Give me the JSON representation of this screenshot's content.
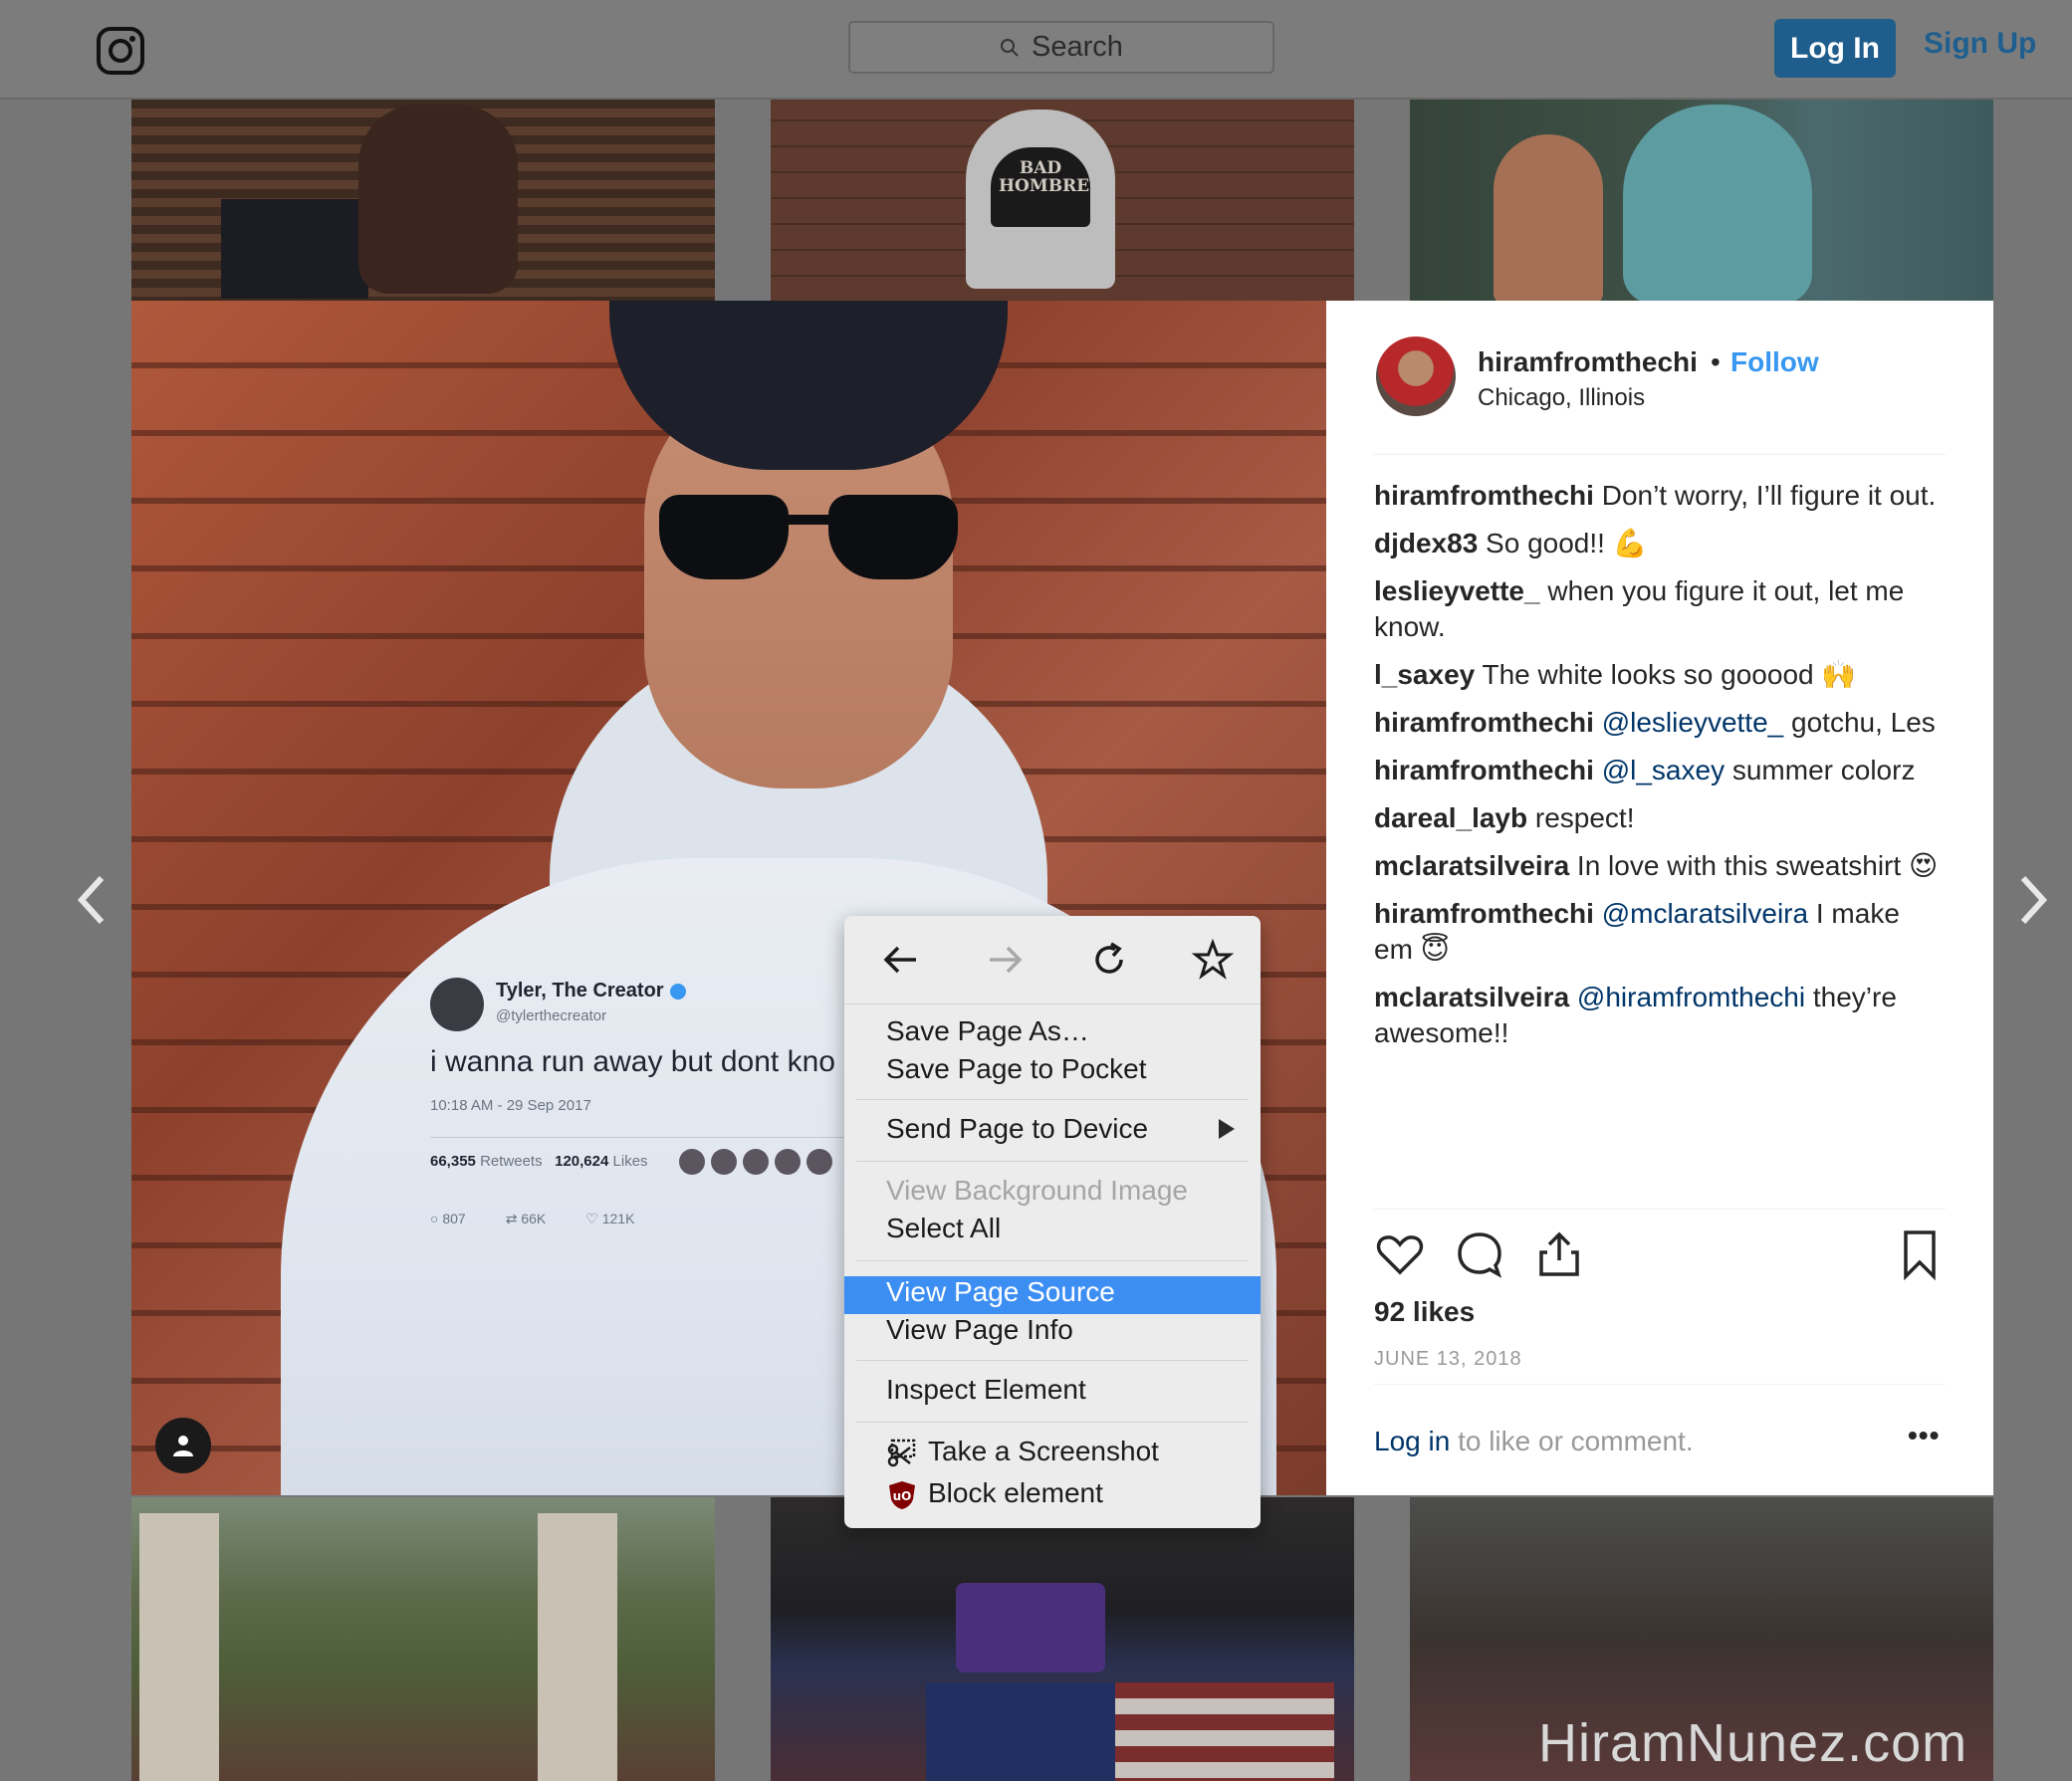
{
  "header": {
    "search_placeholder": "Search",
    "login_label": "Log In",
    "signup_label": "Sign Up"
  },
  "grid": {
    "hat_text": "BAD HOMBRE"
  },
  "post_image": {
    "tweet": {
      "name": "Tyler, The Creator",
      "handle": "@tylerthecreator",
      "text": "i wanna run away but dont kno",
      "time": "10:18 AM - 29 Sep 2017",
      "retweets_count": "66,355",
      "retweets_label": "Retweets",
      "likes_count": "120,624",
      "likes_label": "Likes",
      "reply_count": "807",
      "retweet_count_short": "66K",
      "like_count_short": "121K"
    }
  },
  "post": {
    "username": "hiramfromthechi",
    "separator": "•",
    "follow_label": "Follow",
    "location": "Chicago, Illinois",
    "likes": "92 likes",
    "date": "JUNE 13, 2018",
    "login_link": "Log in",
    "login_rest": " to like or comment.",
    "more": "•••",
    "comments": [
      {
        "user": "hiramfromthechi",
        "mention": "",
        "text": " Don’t worry, I’ll figure it out."
      },
      {
        "user": "djdex83",
        "mention": "",
        "text": " So good!! 💪"
      },
      {
        "user": "leslieyvette_",
        "mention": "",
        "text": " when you figure it out, let me know."
      },
      {
        "user": "l_saxey",
        "mention": "",
        "text": " The white looks so gooood 🙌"
      },
      {
        "user": "hiramfromthechi",
        "mention": " @leslieyvette_",
        "text": " gotchu, Les"
      },
      {
        "user": "hiramfromthechi",
        "mention": " @l_saxey",
        "text": " summer colorz"
      },
      {
        "user": "dareal_layb",
        "mention": "",
        "text": " respect!"
      },
      {
        "user": "mclaratsilveira",
        "mention": "",
        "text": " In love with this sweatshirt 😍"
      },
      {
        "user": "hiramfromthechi",
        "mention": " @mclaratsilveira",
        "text": " I make em 😇"
      },
      {
        "user": "mclaratsilveira",
        "mention": " @hiramfromthechi",
        "text": " they’re awesome!!"
      }
    ]
  },
  "context_menu": {
    "save_page_as": "Save Page As…",
    "save_to_pocket": "Save Page to Pocket",
    "send_to_device": "Send Page to Device",
    "view_bg_image": "View Background Image",
    "select_all": "Select All",
    "view_source": "View Page Source",
    "view_info": "View Page Info",
    "inspect": "Inspect Element",
    "screenshot": "Take a Screenshot",
    "block": "Block element"
  },
  "watermark": "HiramNunez.com",
  "colors": {
    "link_blue": "#3897f0",
    "mention_blue": "#003569",
    "menu_highlight": "#3d8ef3",
    "login_button": "#1e5d8c"
  }
}
